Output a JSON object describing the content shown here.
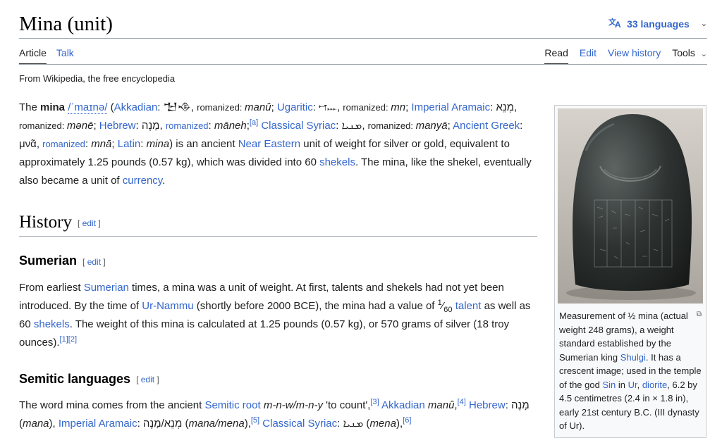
{
  "page": {
    "title": "Mina (unit)",
    "languages_label": "33 languages",
    "tagline": "From Wikipedia, the free encyclopedia"
  },
  "tabs": {
    "article": "Article",
    "talk": "Talk",
    "read": "Read",
    "edit": "Edit",
    "view_history": "View history",
    "tools": "Tools"
  },
  "lead": {
    "t1": "The ",
    "mina": "mina",
    "ipa": "/ˈmaɪnə/",
    "t2": " (",
    "akkadian": "Akkadian",
    "cuneiform": "𒈠𒈾",
    "romanized1": "romanized: ",
    "manu": "manû",
    "sep1": "; ",
    "ugaritic": "Ugaritic",
    "ugaritic_script": "𐎎𐎐",
    "romanized2": "romanized: ",
    "mn": "mn",
    "imperial_aramaic": "Imperial Aramaic",
    "aramaic_script": "מְנֵא",
    "romanized3": "romanized: ",
    "mene": "mənē",
    "hebrew": "Hebrew",
    "hebrew_script": "מָנֶה",
    "romanized4": "romanized",
    "maneh": "māneh",
    "ref_a": "[a]",
    "classical_syriac": "Classical Syriac",
    "syriac_script": "ܡܢܝܐ",
    "romanized5": "romanized: ",
    "manya": "manyā",
    "ancient_greek": "Ancient Greek",
    "greek_script": "μνᾶ",
    "romanized6": "romanized",
    "mna": "mnā",
    "latin": "Latin",
    "latin_word": "mina",
    "t3": ") is an ancient ",
    "near_eastern": "Near Eastern",
    "t4": " unit of weight for silver or gold, equivalent to approximately 1.25 pounds (0.57 kg), which was divided into 60 ",
    "shekels": "shekels",
    "t5": ". The mina, like the shekel, eventually also became a unit of ",
    "currency": "currency",
    "t6": "."
  },
  "history": {
    "heading": "History",
    "edit": "edit"
  },
  "sumerian": {
    "heading": "Sumerian",
    "edit": "edit",
    "t1": "From earliest ",
    "sumerian_link": "Sumerian",
    "t2": " times, a mina was a unit of weight. At first, talents and shekels had not yet been introduced. By the time of ",
    "ur_nammu": "Ur-Nammu",
    "t3": " (shortly before 2000 BCE), the mina had a value of ",
    "frac_num": "1",
    "frac_den": "60",
    "talent": "talent",
    "t4": " as well as 60 ",
    "shekels": "shekels",
    "t5": ". The weight of this mina is calculated at 1.25 pounds (0.57 kg), or 570 grams of silver (18 troy ounces).",
    "ref1": "[1]",
    "ref2": "[2]"
  },
  "semitic": {
    "heading": "Semitic languages",
    "edit": "edit",
    "t1": "The word mina comes from the ancient ",
    "semitic_root": "Semitic root",
    "root": "m-n-w/m-n-y",
    "t2": " 'to count',",
    "ref3": "[3]",
    "akkadian": "Akkadian",
    "manu": "manû",
    "ref4": "[4]",
    "hebrew": "Hebrew",
    "hebrew_script": "מָנֶה",
    "mana": "mana",
    "imperial_aramaic": "Imperial Aramaic",
    "aramaic_script": "מְנֵא/מָנֶה",
    "mana_mena": "mana/mena",
    "ref5": "[5]",
    "classical_syriac": "Classical Syriac",
    "syriac_script": "ܡܢܝܐ",
    "mena": "mena",
    "ref6": "[6]"
  },
  "infobox": {
    "c1": "Measurement of ½ mina (actual weight 248 grams), a weight standard established by the Sumerian king ",
    "shulgi": "Shulgi",
    "c2": ". It has a crescent image; used in the temple of the god ",
    "sin": "Sin",
    "c3": " in ",
    "ur": "Ur",
    "c4": ", ",
    "diorite": "diorite",
    "c5": ", 6.2 by 4.5 centimetres (2.4 in × 1.8 in), early 21st century B.C. (III dynasty of Ur)."
  }
}
